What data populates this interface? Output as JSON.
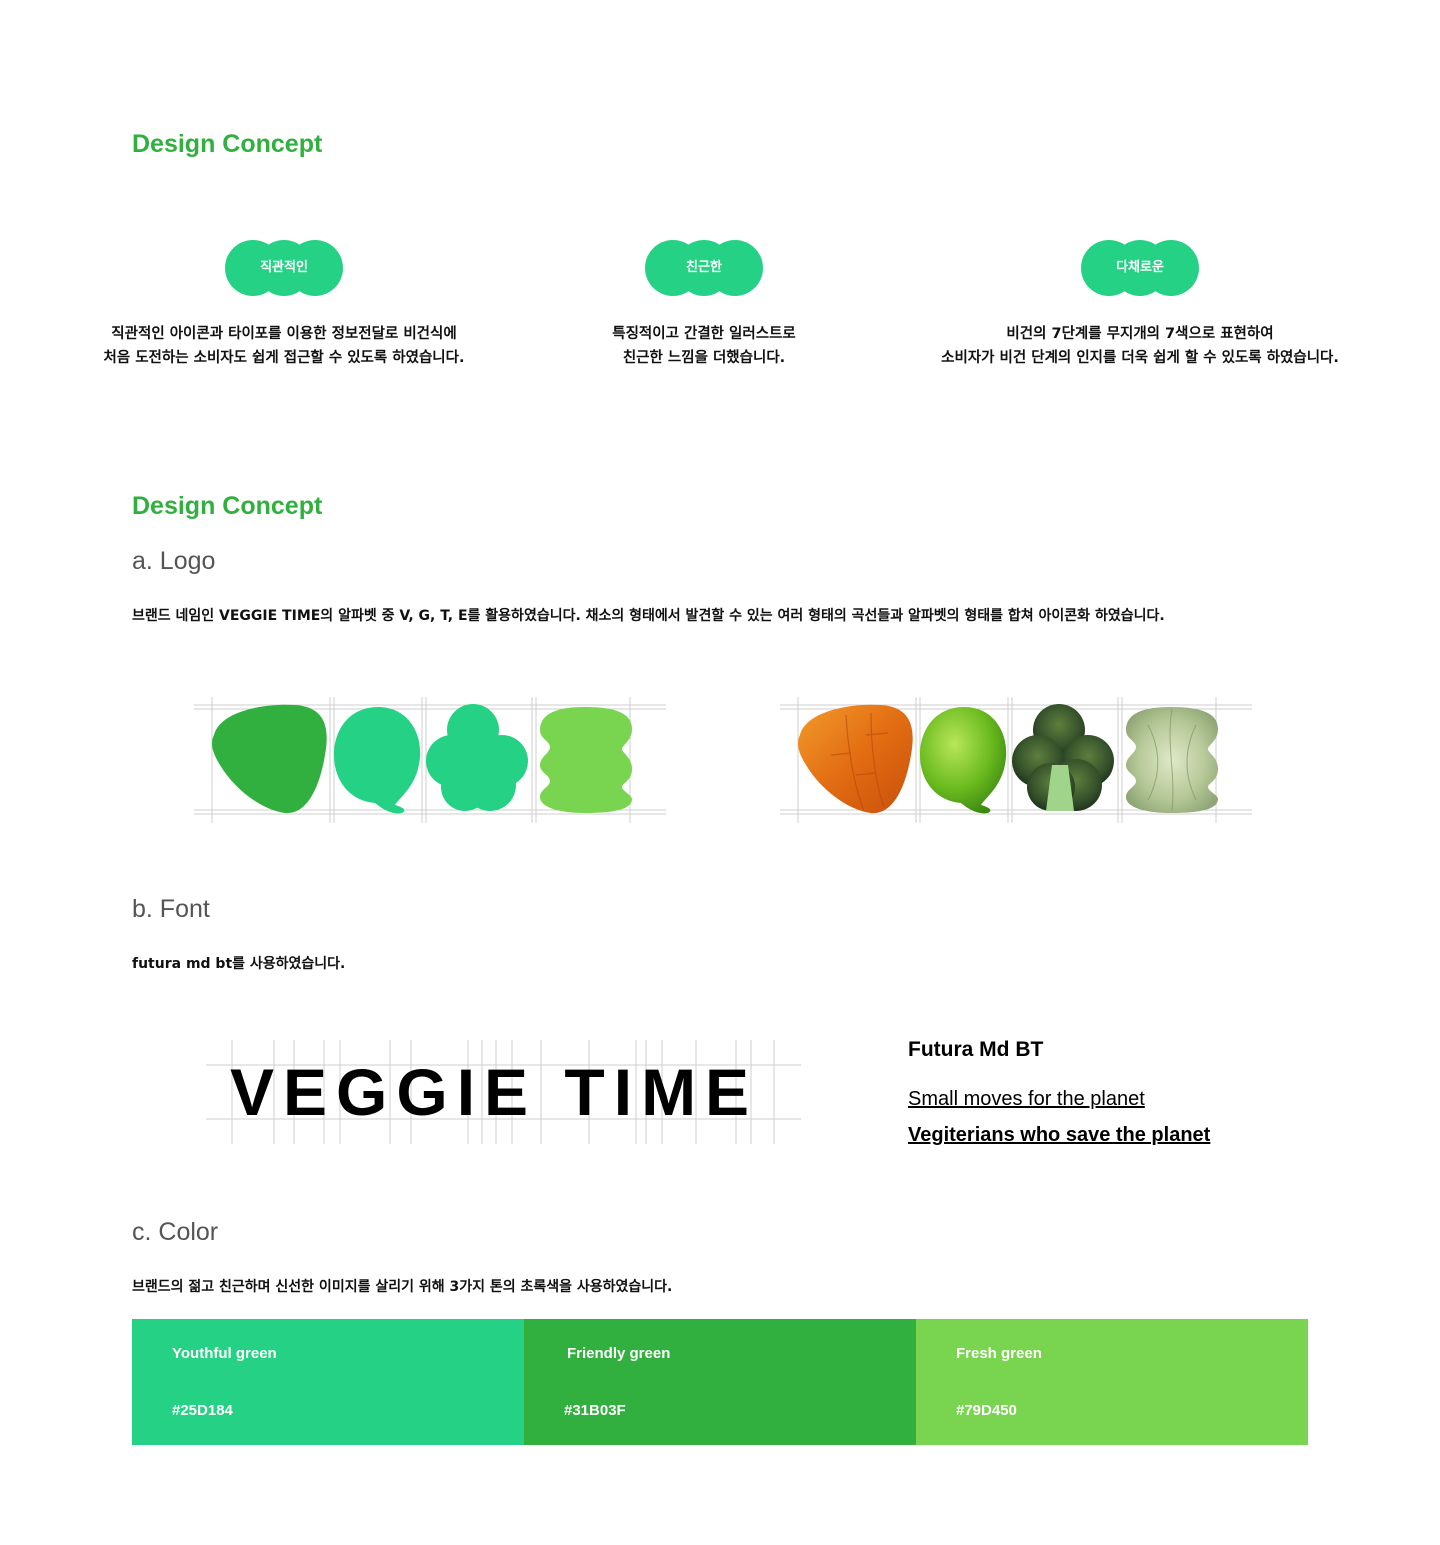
{
  "section1": {
    "title": "Design Concept",
    "concepts": [
      {
        "label": "직관적인",
        "line1": "직관적인 아이콘과 타이포를 이용한 정보전달로 비건식에",
        "line2": "처음 도전하는 소비자도 쉽게 접근할 수 있도록 하였습니다."
      },
      {
        "label": "친근한",
        "line1": "특징적이고 간결한 일러스트로",
        "line2": "친근한 느낌을 더했습니다."
      },
      {
        "label": "다채로운",
        "line1": "비건의 7단계를 무지개의 7색으로 표현하여",
        "line2": "소비자가 비건 단계의 인지를 더욱 쉽게 할 수 있도록 하였습니다."
      }
    ]
  },
  "section2": {
    "title": "Design Concept",
    "logo": {
      "heading": "a. Logo",
      "description": "브랜드 네임인 VEGGIE TIME의 알파벳 중 V, G, T, E를 활용하였습니다.  채소의 형태에서 발견할 수 있는 여러 형태의 곡선들과 알파벳의 형태를 합쳐 아이콘화 하였습니다.",
      "photo_fills": [
        "carrot",
        "green pepper",
        "broccoli",
        "cabbage"
      ]
    },
    "font": {
      "heading": "b. Font",
      "description": "futura md bt를 사용하였습니다.",
      "wordmark": "VEGGIE TIME",
      "font_name": "Futura Md BT",
      "sample1": "Small moves for the planet",
      "sample2": "Vegiterians who save the planet"
    },
    "color": {
      "heading": "c. Color",
      "description": "브랜드의 젊고 친근하며 신선한 이미지를 살리기 위해 3가지 톤의 초록색을 사용하였습니다.",
      "swatches": [
        {
          "name": "Youthful green",
          "hex": "#25D184"
        },
        {
          "name": "Friendly green",
          "hex": "#31B03F"
        },
        {
          "name": "Fresh green",
          "hex": "#79D450"
        }
      ]
    }
  },
  "colors": {
    "accent": "#31B03F",
    "youthful": "#25D184",
    "friendly": "#31B03F",
    "fresh": "#79D450"
  }
}
